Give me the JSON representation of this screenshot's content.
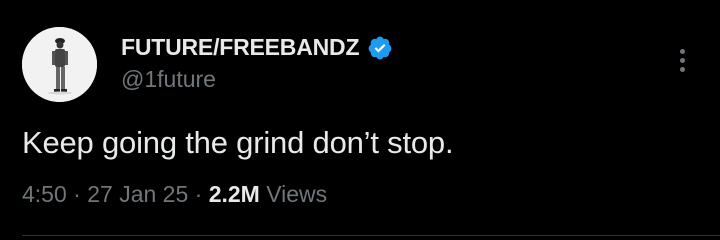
{
  "author": {
    "name": "FUTURE/FREEBANDZ",
    "handle": "@1future",
    "verified": true
  },
  "tweet": {
    "text": "Keep going the grind don’t stop.",
    "time": "4:50",
    "separator": " · ",
    "date": "27 Jan 25",
    "views_count": "2.2M",
    "views_label": " Views"
  },
  "colors": {
    "background": "#000000",
    "primary_text": "#e7e9ea",
    "secondary_text": "#71767b",
    "verified_badge": "#1d9bf0",
    "divider": "#2f3336"
  },
  "icons": {
    "verified": "verified-badge-icon",
    "more": "more-options-icon"
  }
}
